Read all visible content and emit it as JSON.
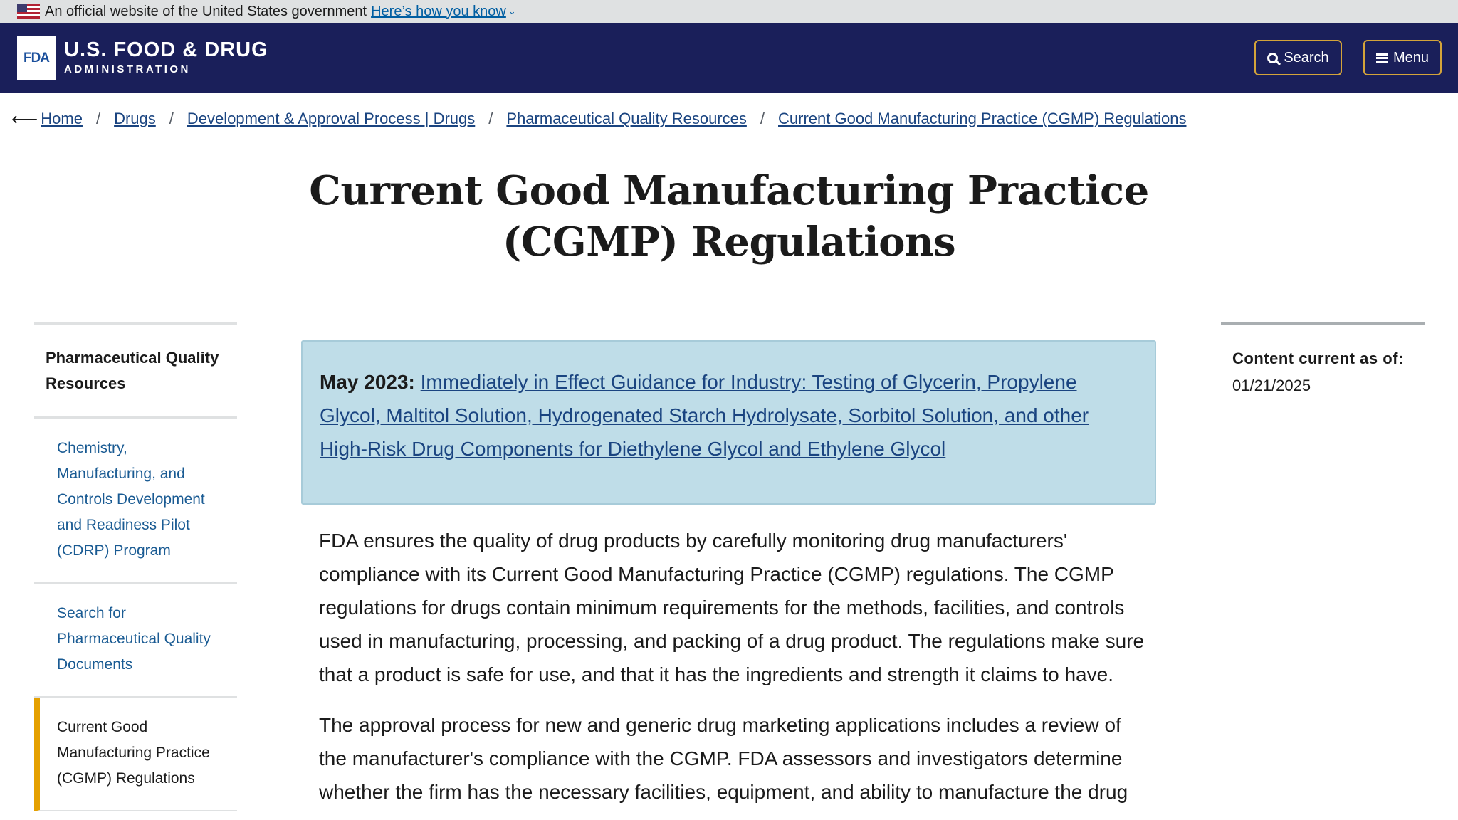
{
  "gov_banner": {
    "text": "An official website of the United States government",
    "link": "Here’s how you know"
  },
  "header": {
    "logo_mark": "FDA",
    "logo_line1": "U.S. FOOD & DRUG",
    "logo_line2": "ADMINISTRATION",
    "search_label": "Search",
    "menu_label": "Menu"
  },
  "breadcrumb": [
    "Home",
    "Drugs",
    "Development & Approval Process | Drugs",
    "Pharmaceutical Quality Resources",
    "Current Good Manufacturing Practice (CGMP) Regulations"
  ],
  "page": {
    "title_line1": "Current Good Manufacturing Practice",
    "title_line2": "(CGMP) Regulations"
  },
  "left_nav": {
    "title": "Pharmaceutical Quality Resources",
    "items": [
      {
        "label": "Chemistry, Manufacturing, and Controls Development and Readiness Pilot (CDRP) Program",
        "active": false
      },
      {
        "label": "Search for Pharmaceutical Quality Documents",
        "active": false
      },
      {
        "label": "Current Good Manufacturing Practice (CGMP) Regulations",
        "active": true
      }
    ]
  },
  "alert": {
    "date": "May 2023:",
    "link": "Immediately in Effect Guidance for Industry: Testing of Glycerin, Propylene Glycol, Maltitol Solution, Hydrogenated Starch Hydrolysate, Sorbitol Solution, and other High-Risk Drug Components for Diethylene Glycol and Ethylene Glycol"
  },
  "body": {
    "p1": "FDA ensures the quality of drug products by carefully monitoring drug manufacturers' compliance with its Current Good Manufacturing Practice (CGMP) regulations. The CGMP regulations for drugs contain minimum requirements for the methods, facilities, and controls used in manufacturing, processing, and packing of a drug product. The regulations make sure that a product is safe for use, and that it has the ingredients and strength it claims to have.",
    "p2": "The approval process for new and generic drug marketing applications includes a review of the manufacturer's compliance with the CGMP. FDA assessors and investigators determine whether the firm has the necessary facilities, equipment, and ability to manufacture the drug"
  },
  "sidebar": {
    "content_label": "Content current as of:",
    "content_date": "01/21/2025"
  },
  "colors": {
    "header_bg": "#1a1f5a",
    "alert_bg": "#bfdde8",
    "link": "#1a4480",
    "active_marker": "#e5a000"
  }
}
